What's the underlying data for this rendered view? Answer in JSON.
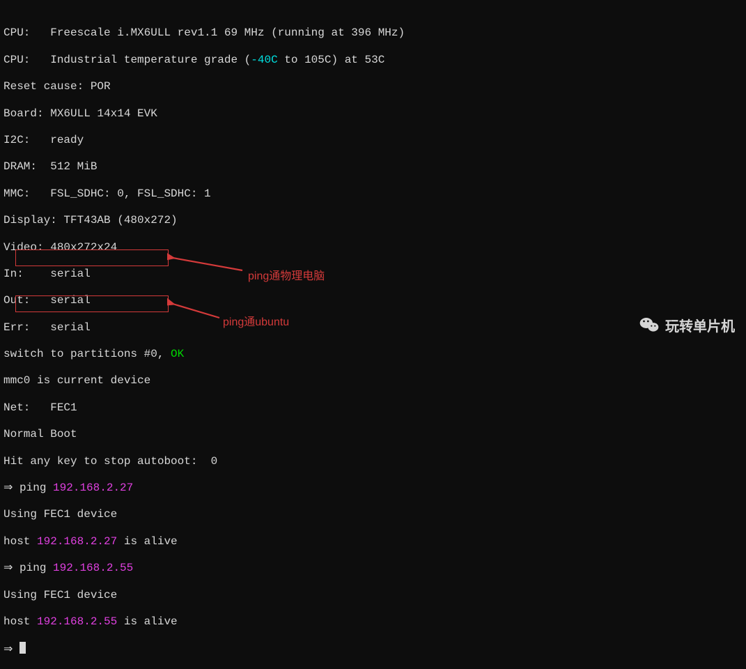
{
  "term": {
    "lines": [
      {
        "pre": "CPU:   ",
        "post": "Freescale i.MX6ULL rev1.1 69 MHz (running at 396 MHz)"
      },
      {
        "pre": "CPU:   ",
        "post_before": "Industrial temperature grade (",
        "cyan": "-40C",
        "post_after": " to 105C) at 53C"
      },
      {
        "text": "Reset cause: POR"
      },
      {
        "text": "Board: MX6ULL 14x14 EVK"
      },
      {
        "pre": "I2C:   ",
        "post": "ready"
      },
      {
        "pre": "DRAM:  ",
        "post": "512 MiB"
      },
      {
        "pre": "MMC:   ",
        "post": "FSL_SDHC: 0, FSL_SDHC: 1"
      },
      {
        "text": "Display: TFT43AB (480x272)"
      },
      {
        "text": "Video: 480x272x24"
      },
      {
        "pre": "In:    ",
        "post": "serial"
      },
      {
        "pre": "Out:   ",
        "post": "serial"
      },
      {
        "pre": "Err:   ",
        "post": "serial"
      },
      {
        "pre_text": "switch to partitions #0, ",
        "ok": "OK"
      },
      {
        "text": "mmc0 is current device"
      },
      {
        "pre": "Net:   ",
        "post": "FEC1"
      },
      {
        "text": "Normal Boot"
      },
      {
        "text": "Hit any key to stop autoboot:  0"
      },
      {
        "prompt": "⇒ ",
        "cmd": "ping ",
        "ip": "192.168.2.27"
      },
      {
        "text": "Using FEC1 device"
      },
      {
        "pre_text": "host ",
        "ip": "192.168.2.27",
        "post_text": " is alive"
      },
      {
        "prompt": "⇒ ",
        "cmd": "ping ",
        "ip": "192.168.2.55"
      },
      {
        "text": "Using FEC1 device"
      },
      {
        "pre_text": "host ",
        "ip": "192.168.2.55",
        "post_text": " is alive"
      },
      {
        "prompt": "⇒ ",
        "cursor": true
      }
    ]
  },
  "annotations": {
    "label1": "ping通物理电脑",
    "label2": "ping通ubuntu"
  },
  "watermark": {
    "text": "玩转单片机"
  }
}
